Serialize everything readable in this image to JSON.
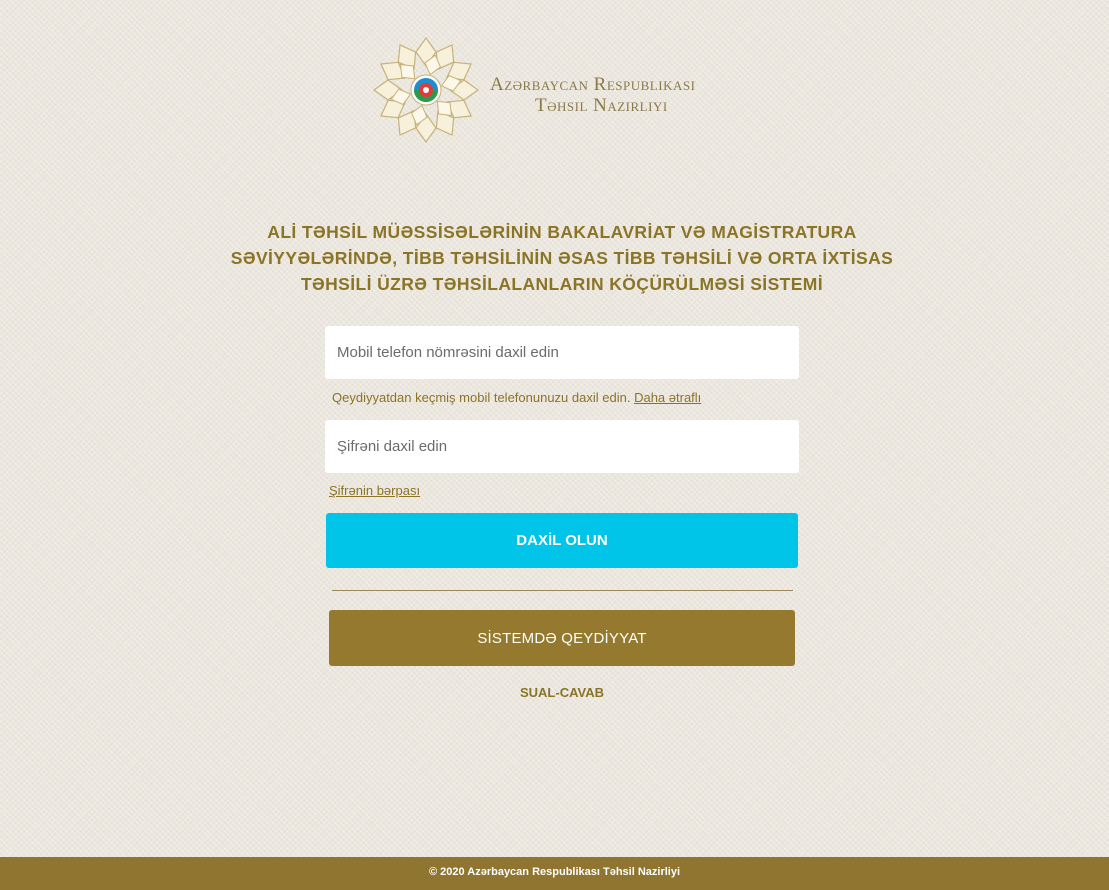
{
  "header": {
    "emblem_icon": "ministry-emblem",
    "ministry_line1": "Azərbaycan Respublikası",
    "ministry_line2": "Təhsil Nazirliyi"
  },
  "title": {
    "line1": "ALİ TƏHSİL MÜƏSSİSƏLƏRİNİN BAKALAVRİAT VƏ MAGİSTRATURA",
    "line2": "SƏVİYYƏLƏRİNDƏ, TİBB TƏHSİLİNİN ƏSAS TİBB TƏHSİLİ VƏ ORTA İXTİSAS",
    "line3": "TƏHSİLİ ÜZRƏ TƏHSİLALANLARIN KÖÇÜRÜLMƏSİ SİSTEMİ"
  },
  "login_form": {
    "phone_placeholder": "Mobil telefon nömrəsini daxil edin",
    "phone_value": "",
    "phone_hint": "Qeydiyyatdan keçmiş mobil telefonunuzu daxil edin.",
    "phone_hint_link": "Daha ətraflı",
    "password_placeholder": "Şifrəni daxil edin",
    "password_value": "",
    "recover_link": "Şifrənin bərpası",
    "login_button": "DAXİL OLUN",
    "register_button": "SİSTEMDƏ QEYDİYYAT",
    "faq_link": "SUAL-CAVAB"
  },
  "footer": {
    "copyright": "© 2020 Azərbaycan Respublikası Təhsil Nazirliyi"
  },
  "colors": {
    "background": "#ebe7df",
    "gold": "#8a7428",
    "login_button": "#00c5e8",
    "register_button": "#94792e",
    "footer": "#8f7530"
  }
}
